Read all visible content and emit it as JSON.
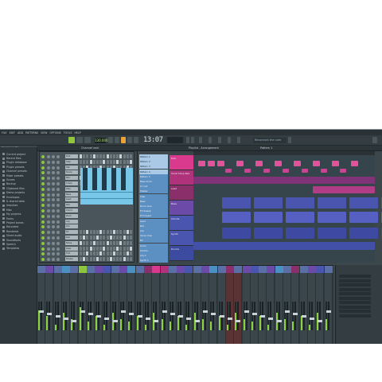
{
  "menu": {
    "items": [
      "FILE",
      "EDIT",
      "ADD",
      "PATTERNS",
      "VIEW",
      "OPTIONS",
      "TOOLS",
      "HELP"
    ]
  },
  "toolbar": {
    "tempo": "130.000",
    "time": "13:07",
    "hint_prefix": "Record nor file",
    "hint_text": "Reconnect the ruler"
  },
  "tabs": {
    "channel_rack": "Channel rack",
    "playlist": "Playlist - Arrangement",
    "pattern": "Pattern 1"
  },
  "browser": {
    "items": [
      "Current project",
      "Recent files",
      "Plugin database",
      "Plugin presets",
      "Channel presets",
      "Mixer presets",
      "Scores",
      "Backup",
      "Clipboard files",
      "Demo projects",
      "Envelopes",
      "IL shared data",
      "Impulses",
      "Misc",
      "My projects",
      "Packs",
      "Project bones",
      "Recorded",
      "Rendered",
      "Sliced audio",
      "Soundfonts",
      "Speech",
      "Templates"
    ]
  },
  "rack": {
    "channels": [
      "Kick",
      "Clap",
      "Hat",
      "Snare",
      "Perc",
      "Crash",
      "Ride",
      "Bass",
      "Lead",
      "Pad",
      "Chord",
      "Pluck",
      "Arp",
      "Vox",
      "FX",
      "Sub",
      "Noise",
      "Riser",
      "Tom",
      "Shaker"
    ]
  },
  "patterns": [
    "Pattern 1",
    "Pattern 2",
    "Pattern 3",
    "Pattern 4",
    "Pattern 5",
    "Bass drum",
    "Cl. hat",
    "Shaker",
    "Clap",
    "Bass",
    "Drum loop",
    "FX Sweep",
    "FX Impact",
    "Lead",
    "Pad",
    "Arp",
    "Vocal chop",
    "Fill",
    "Outro",
    "Chords",
    "Arp 2",
    "Synth 1"
  ],
  "tracks": [
    "Kick",
    "Vocal Chop Pad",
    "Lead",
    "Bass",
    "Chords",
    "Synth",
    "Drums"
  ],
  "mixer": {
    "insert_count": 36
  },
  "colors": {
    "accent_pink": "#d93a8e",
    "accent_purple": "#6b4aa8",
    "accent_blue": "#4a55b0",
    "accent_green": "#8cc63f",
    "accent_orange": "#e8a33b"
  }
}
